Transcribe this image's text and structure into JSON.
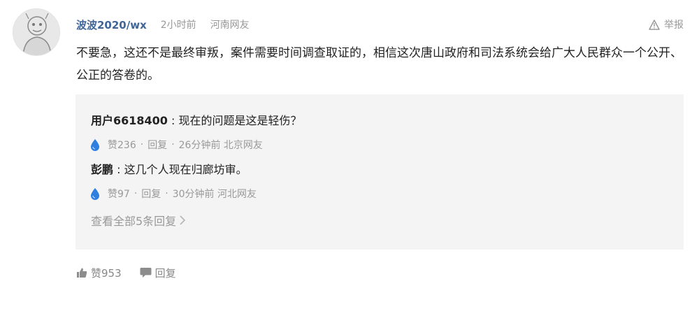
{
  "comment": {
    "username": "波波2020/wx",
    "time": "2小时前",
    "location": "河南网友",
    "report_label": "举报",
    "content": "不要急，这还不是最终审叛，案件需要时间调查取证的，相信这次唐山政府和司法系统会给广大人民群众一个公开、公正的答卷的。",
    "like_label": "赞953",
    "reply_label": "回复"
  },
  "replies": [
    {
      "user": "用户6618400",
      "text": "现在的问题是这是轻伤？",
      "likes": "赞236",
      "reply_action": "回复",
      "time_location": "26分钟前 北京网友"
    },
    {
      "user": "彭鹏",
      "text": "这几个人现在归廊坊审。",
      "likes": "赞97",
      "reply_action": "回复",
      "time_location": "30分钟前 河北网友"
    }
  ],
  "view_all_label": "查看全部5条回复",
  "icons": {
    "report": "warning-triangle-icon",
    "like_drop": "water-drop-icon",
    "thumbs_up": "thumbs-up-icon",
    "reply_bubble": "chat-bubble-icon",
    "chevron": "chevron-right-icon"
  },
  "colors": {
    "username": "#406599",
    "muted": "#999999",
    "reply_background": "#f4f4f4",
    "drop_blue": "#2f7fe0"
  }
}
